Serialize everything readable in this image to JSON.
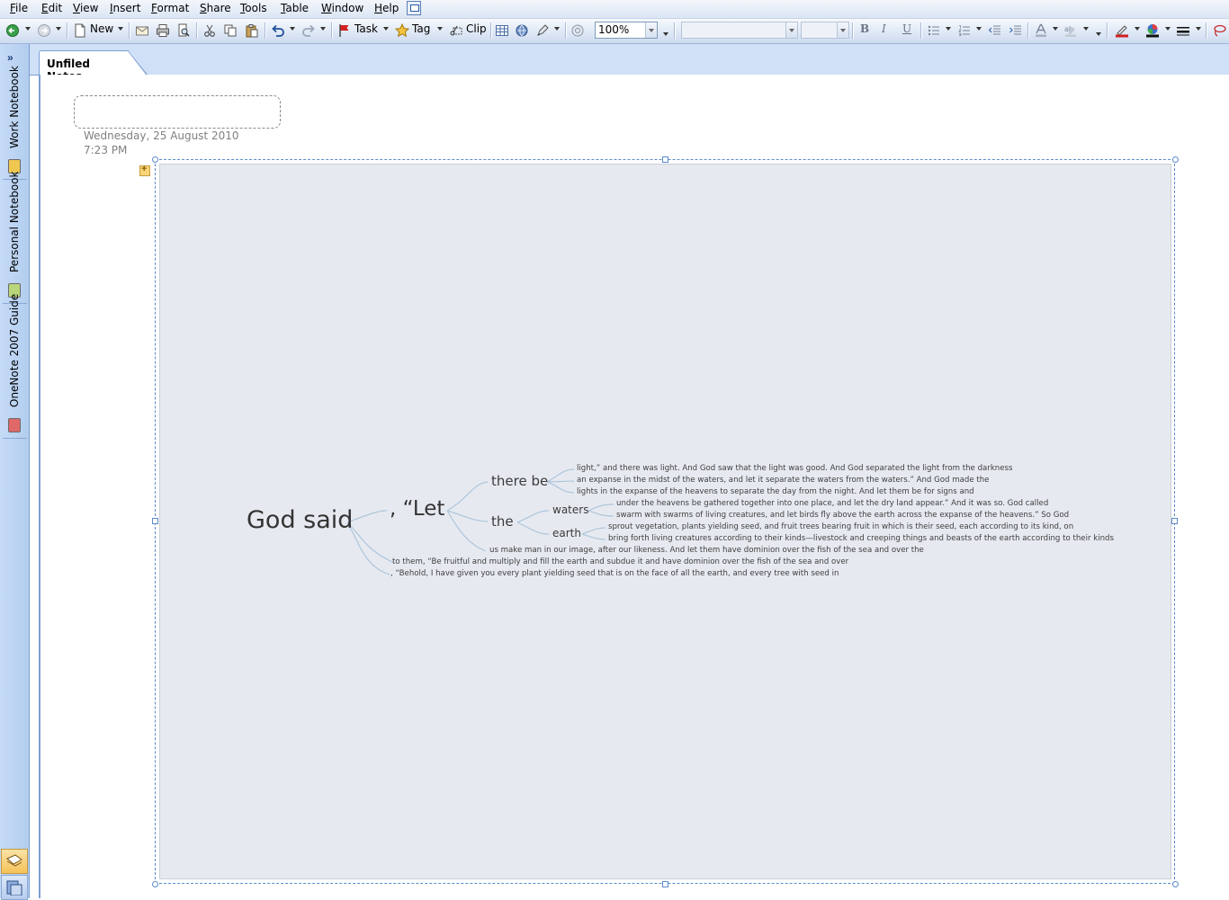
{
  "menu": [
    "File",
    "Edit",
    "View",
    "Insert",
    "Format",
    "Share",
    "Tools",
    "Table",
    "Window",
    "Help"
  ],
  "toolbar": {
    "new_label": "New",
    "task_label": "Task",
    "tag_label": "Tag",
    "clip_label": "Clip",
    "zoom_value": "100%",
    "font_value": "",
    "size_value": "",
    "bold": "B",
    "italic": "I",
    "underline": "U"
  },
  "nav": {
    "collapse": "»",
    "notebooks": [
      {
        "label": "Work Notebook",
        "color": "#f0c850"
      },
      {
        "label": "Personal Notebook",
        "color": "#b8d67a"
      },
      {
        "label": "OneNote 2007 Guide",
        "color": "#e06868"
      }
    ]
  },
  "section_tab": "Unfiled Notes",
  "page": {
    "title": "",
    "date": "Wednesday, 25 August 2010",
    "time": "7:23 PM"
  },
  "mindmap": {
    "root": "God said",
    "l1": ", “Let",
    "l2": [
      "there be",
      "the"
    ],
    "l3": [
      "waters",
      "earth"
    ],
    "there_be_leaves": [
      "light,” and there was light. And God saw that the light was good. And God separated the light from the darkness",
      "an expanse in the midst of the waters, and let it separate the waters from the waters.” And God made the",
      "lights in the expanse of the heavens to separate the day from the night. And let them be for signs and"
    ],
    "waters_leaves": [
      "under the heavens be gathered together into one place, and let the dry land appear.” And it was so. God called",
      "swarm with swarms of living creatures, and let birds fly above the earth across the expanse of the heavens.” So God"
    ],
    "earth_leaves": [
      "sprout vegetation, plants yielding seed, and fruit trees bearing fruit in which is their seed, each according to its kind, on",
      "bring forth living creatures according to their kinds—livestock and creeping things and beasts of the earth according to their kinds"
    ],
    "let_leaf": "us make man in our image, after our likeness. And let them have dominion over the fish of the sea and over the",
    "root_leaves": [
      "to them, “Be fruitful and multiply and fill the earth and subdue it and have dominion over the fish of the sea and over",
      ", “Behold, I have given you every plant yielding seed that is on the face of all the earth, and every tree with seed in"
    ]
  }
}
